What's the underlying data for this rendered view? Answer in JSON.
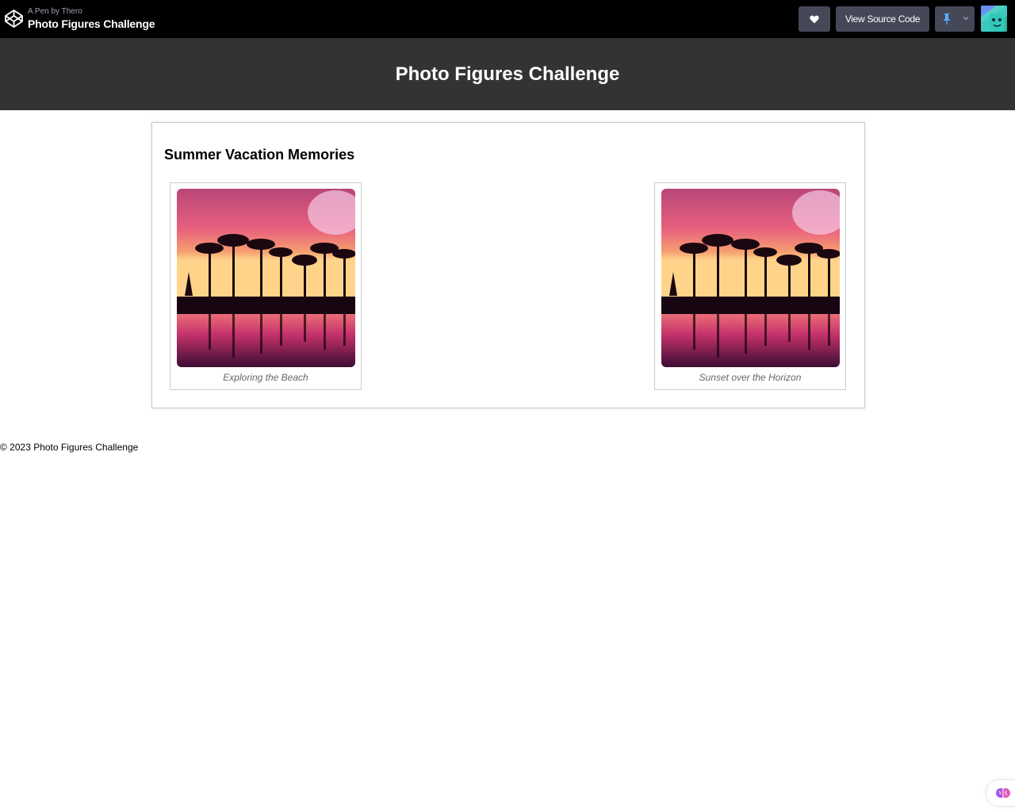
{
  "codepen": {
    "byline": "A Pen by Thero",
    "pen_title": "Photo Figures Challenge",
    "source_button": "View Source Code",
    "icons": [
      "codepen-logo-icon",
      "heart-icon",
      "pin-icon",
      "chevron-down-icon",
      "avatar"
    ]
  },
  "header": {
    "title": "Photo Figures Challenge"
  },
  "gallery": {
    "heading": "Summer Vacation Memories",
    "figures": [
      {
        "caption": "Exploring the Beach",
        "image": "sunset palm trees reflected in pool"
      },
      {
        "caption": "Sunset over the Horizon",
        "image": "sunset palm trees reflected in pool"
      }
    ]
  },
  "footer": {
    "text": "© 2023 Photo Figures Challenge"
  },
  "colors": {
    "topbar": "#000000",
    "header": "#333333",
    "button": "#444857",
    "accent_pin": "#47cf73"
  }
}
